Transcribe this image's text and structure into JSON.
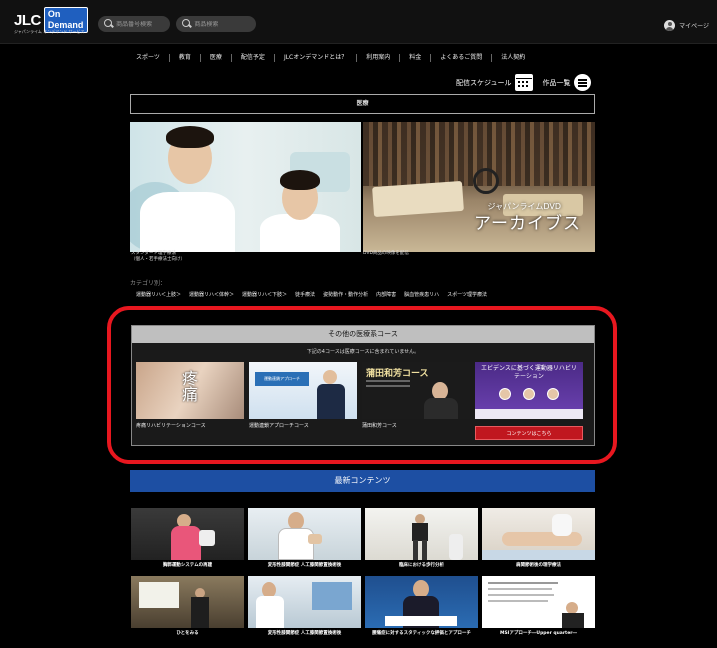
{
  "header": {
    "logo_main": "JLC",
    "logo_badge": "On Demand",
    "logo_sub": "ジャパンライム オンデマンド サービス",
    "search_number_placeholder": "商品番号検索",
    "search_keyword_placeholder": "商品検索",
    "mypage_label": "マイページ"
  },
  "nav": {
    "items": [
      "スポーツ",
      "教育",
      "医療",
      "配信予定",
      "JLCオンデマンドとは？",
      "利用案内",
      "料金",
      "よくあるご質問",
      "法人契約"
    ]
  },
  "schedule": {
    "schedule_label": "配信スケジュール",
    "list_label": "作品一覧"
  },
  "category": {
    "title": "医療",
    "hero_left_caption_1": "スタンダード理学療法",
    "hero_left_caption_2": "（個人・若手療法士向け）",
    "hero_right_caption": "DVD商品の映像を配信",
    "archive_sub": "ジャパンライムDVD",
    "archive_title": "アーカイブス",
    "label": "カテゴリ別：",
    "links": [
      "運動器リハ＜上肢＞",
      "運動器リハ＜体幹＞",
      "運動器リハ＜下肢＞",
      "徒手療法",
      "姿勢動作・動作分析",
      "内部障害",
      "脳血管疾患リハ",
      "スポーツ理学療法"
    ]
  },
  "other_courses": {
    "title": "その他の医療系コース",
    "note": "下記の4コースは医療コースに含まれていません。",
    "courses": [
      {
        "label": "疼痛リハビリテーションコース",
        "thumb_text": "疼痛"
      },
      {
        "label": "運動連鎖アプローチコース",
        "thumb_text": "運動連鎖アプローチ"
      },
      {
        "label": "蒲田和芳コース",
        "thumb_text": "蒲田和芳コース"
      },
      {
        "label": "",
        "thumb_text": "エビデンスに基づく運動器リハビリテーション"
      }
    ],
    "cta_label": "コンテンツはこちら"
  },
  "latest": {
    "title": "最新コンテンツ",
    "items": [
      {
        "title": "胸郭運動システムの再建"
      },
      {
        "title": "変形性膝関節症 人工膝関節置換術後"
      },
      {
        "title": "臨床における歩行分析"
      },
      {
        "title": "肩関節術後の理学療法"
      },
      {
        "title": "ひとをみる"
      },
      {
        "title": "変形性膝関節症 人工膝関節置換術後"
      },
      {
        "title": "腰痛症に対するスタティックな評価とアプローチ"
      },
      {
        "title": "MSIアプローチ―Upper quarter―"
      }
    ]
  },
  "colors": {
    "highlight_ring": "#e8171f",
    "latest_bar": "#1d4fa3",
    "cta": "#c0171f"
  }
}
